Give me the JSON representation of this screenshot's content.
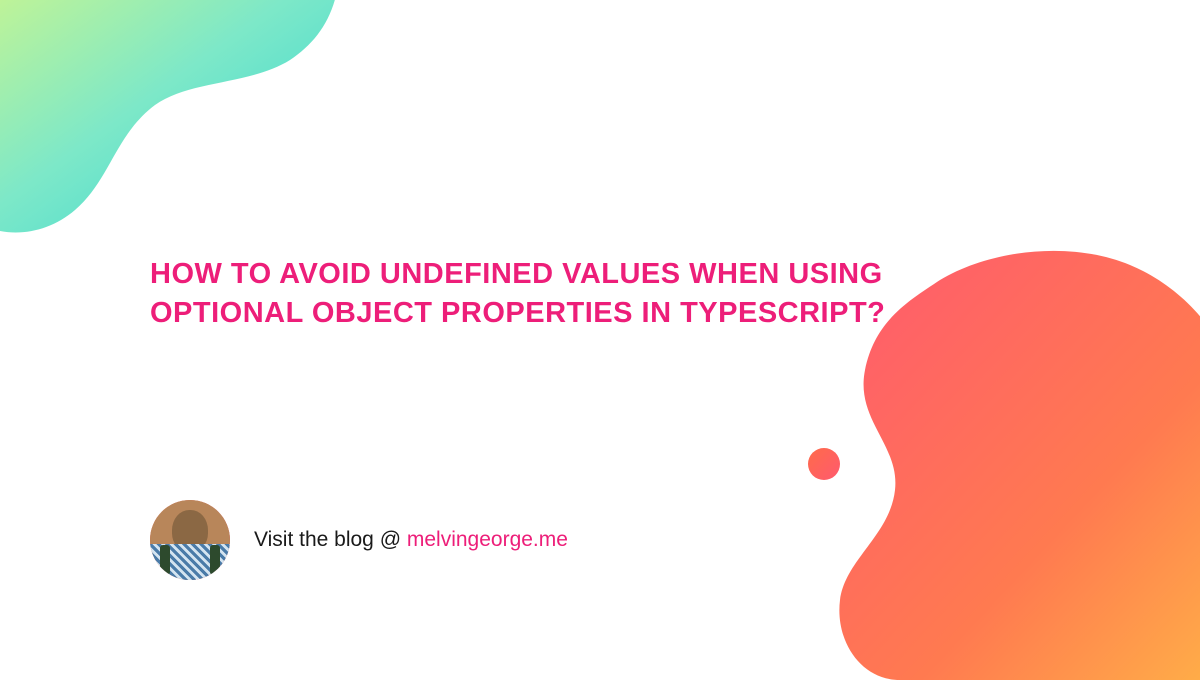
{
  "title": "HOW TO AVOID UNDEFINED VALUES WHEN USING OPTIONAL OBJECT PROPERTIES IN TYPESCRIPT?",
  "footer": {
    "prefix": "Visit the blog @ ",
    "link": "melvingeorge.me"
  },
  "colors": {
    "accent": "#ed1e79",
    "gradient_green_start": "#c8f582",
    "gradient_green_end": "#2dd4bf",
    "gradient_orange_start": "#ff8a4c",
    "gradient_orange_end": "#ff4d7a"
  }
}
